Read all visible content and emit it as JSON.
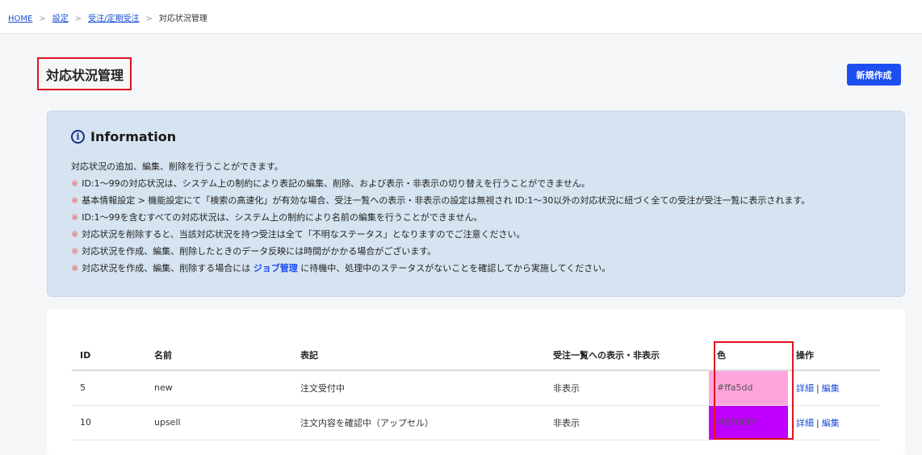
{
  "breadcrumb": {
    "items": [
      "HOME",
      "設定",
      "受注/定期受注"
    ],
    "separator": ">",
    "current": "対応状況管理"
  },
  "page": {
    "title": "対応状況管理",
    "new_button": "新規作成"
  },
  "info": {
    "icon_glyph": "i",
    "title": "Information",
    "line1": "対応状況の追加、編集、削除を行うことができます。",
    "mark": "※",
    "line2": "ID:1～99の対応状況は、システム上の制約により表記の編集、削除、および表示・非表示の切り替えを行うことができません。",
    "line3": "基本情報設定 > 機能設定にて「検索の高速化」が有効な場合、受注一覧への表示・非表示の設定は無視され ID:1～30以外の対応状況に紐づく全ての受注が受注一覧に表示されます。",
    "line4": "ID:1～99を含むすべての対応状況は、システム上の制約により名前の編集を行うことができません。",
    "line5": "対応状況を削除すると、当該対応状況を持つ受注は全て「不明なステータス」となりますのでご注意ください。",
    "line6": "対応状況を作成、編集、削除したときのデータ反映には時間がかかる場合がございます。",
    "line7_before": "対応状況を作成、編集、削除する場合には",
    "line7_link": "ジョブ管理",
    "line7_after": "に待機中、処理中のステータスがないことを確認してから実施してください。"
  },
  "table": {
    "headers": {
      "id": "ID",
      "name": "名前",
      "label": "表記",
      "visibility": "受注一覧への表示・非表示",
      "color": "色",
      "actions": "操作"
    },
    "rows": [
      {
        "id": "5",
        "name": "new",
        "label": "注文受付中",
        "visibility": "非表示",
        "color": "#ffa5dd",
        "detail": "詳細",
        "edit": "編集"
      },
      {
        "id": "10",
        "name": "upsell",
        "label": "注文内容を確認中（アップセル）",
        "visibility": "非表示",
        "color": "#BF00FF",
        "detail": "詳細",
        "edit": "編集"
      }
    ],
    "action_separator": "|"
  },
  "colors": {
    "primary_button": "#1d4ef0",
    "highlight_border": "#e0141e",
    "info_background": "#d6e4f1",
    "link": "#1a4fd6"
  }
}
